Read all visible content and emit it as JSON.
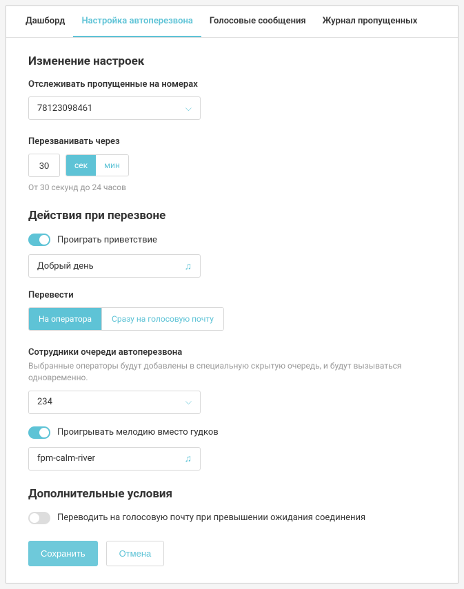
{
  "tabs": [
    {
      "label": "Дашборд",
      "active": false
    },
    {
      "label": "Настройка автоперезвона",
      "active": true
    },
    {
      "label": "Голосовые сообщения",
      "active": false
    },
    {
      "label": "Журнал пропущенных",
      "active": false
    }
  ],
  "section1": {
    "title": "Изменение настроек",
    "track_label": "Отслеживать пропущенные на номерах",
    "track_value": "78123098461",
    "callback_label": "Перезванивать через",
    "callback_value": "30",
    "unit_sec": "сек",
    "unit_min": "мин",
    "hint": "От 30 секунд до 24 часов"
  },
  "section2": {
    "title": "Действия при перезвоне",
    "greeting_toggle": "Проиграть приветствие",
    "greeting_value": "Добрый день",
    "transfer_label": "Перевести",
    "transfer_opt1": "На оператора",
    "transfer_opt2": "Сразу на голосовую почту",
    "queue_label": "Сотрудники очереди автоперезвона",
    "queue_desc": "Выбранные операторы будут добавлены в специальную скрытую очередь, и будут вызываться одновременно.",
    "queue_value": "234",
    "melody_toggle": "Проигрывать мелодию вместо гудков",
    "melody_value": "fpm-calm-river"
  },
  "section3": {
    "title": "Дополнительные условия",
    "voicemail_toggle": "Переводить на голосовую почту при превышении ожидания соединения"
  },
  "actions": {
    "save": "Сохранить",
    "cancel": "Отмена"
  }
}
